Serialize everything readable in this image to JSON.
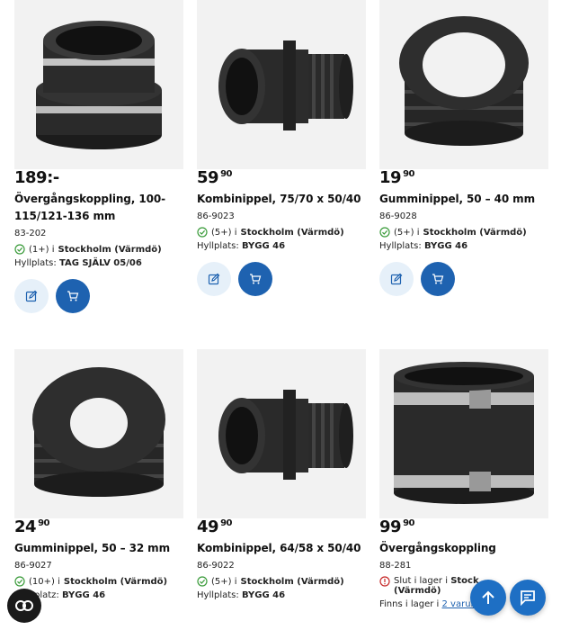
{
  "products": [
    {
      "price_main": "189:-",
      "price_dec": "",
      "title": "Övergångskoppling, 100-115/121-136 mm",
      "sku": "83-202",
      "stock_count": "(1+) i",
      "stock_place": "Stockholm (Värmdö)",
      "shelf_label": "Hyllplats:",
      "shelf_value": "TAG SJÄLV 05/06",
      "stock_status": "in_stock",
      "image": "coupling-banded"
    },
    {
      "price_main": "59",
      "price_dec": "90",
      "title": "Kombinippel, 75/70 x 50/40",
      "sku": "86-9023",
      "stock_count": "(5+) i",
      "stock_place": "Stockholm (Värmdö)",
      "shelf_label": "Hyllplats:",
      "shelf_value": "BYGG 46",
      "stock_status": "in_stock",
      "image": "combi-nipple"
    },
    {
      "price_main": "19",
      "price_dec": "90",
      "title": "Gumminippel, 50 – 40 mm",
      "sku": "86-9028",
      "stock_count": "(5+) i",
      "stock_place": "Stockholm (Värmdö)",
      "shelf_label": "Hyllplats:",
      "shelf_value": "BYGG 46",
      "stock_status": "in_stock",
      "image": "rubber-nipple"
    },
    {
      "price_main": "24",
      "price_dec": "90",
      "title": "Gumminippel, 50 – 32 mm",
      "sku": "86-9027",
      "stock_count": "(10+) i",
      "stock_place": "Stockholm (Värmdö)",
      "shelf_label": "platz:",
      "shelf_value": "BYGG 46",
      "stock_status": "in_stock",
      "image": "rubber-nipple"
    },
    {
      "price_main": "49",
      "price_dec": "90",
      "title": "Kombinippel, 64/58 x 50/40",
      "sku": "86-9022",
      "stock_count": "(5+) i",
      "stock_place": "Stockholm (Värmdö)",
      "shelf_label": "Hyllplats:",
      "shelf_value": "BYGG 46",
      "stock_status": "in_stock",
      "image": "combi-nipple"
    },
    {
      "price_main": "99",
      "price_dec": "90",
      "title": "Övergångskoppling",
      "sku": "88-281",
      "stock_count": "Slut i lager i",
      "stock_place": "Stock",
      "stock_place_2": "(Värmdö)",
      "shelf_label": "Finns i lager i",
      "shelf_value": "2 varuhus",
      "stock_status": "out_of_stock",
      "image": "straight-coupling"
    }
  ],
  "colors": {
    "accent": "#1e62b0",
    "accent_light": "#e6f0f9",
    "check": "#3a9b3a",
    "warn": "#c62828"
  },
  "icons": {
    "edit": "edit-icon",
    "cart": "cart-icon",
    "up": "arrow-up-icon",
    "chat": "chat-icon",
    "cookie": "cookie-icon"
  }
}
